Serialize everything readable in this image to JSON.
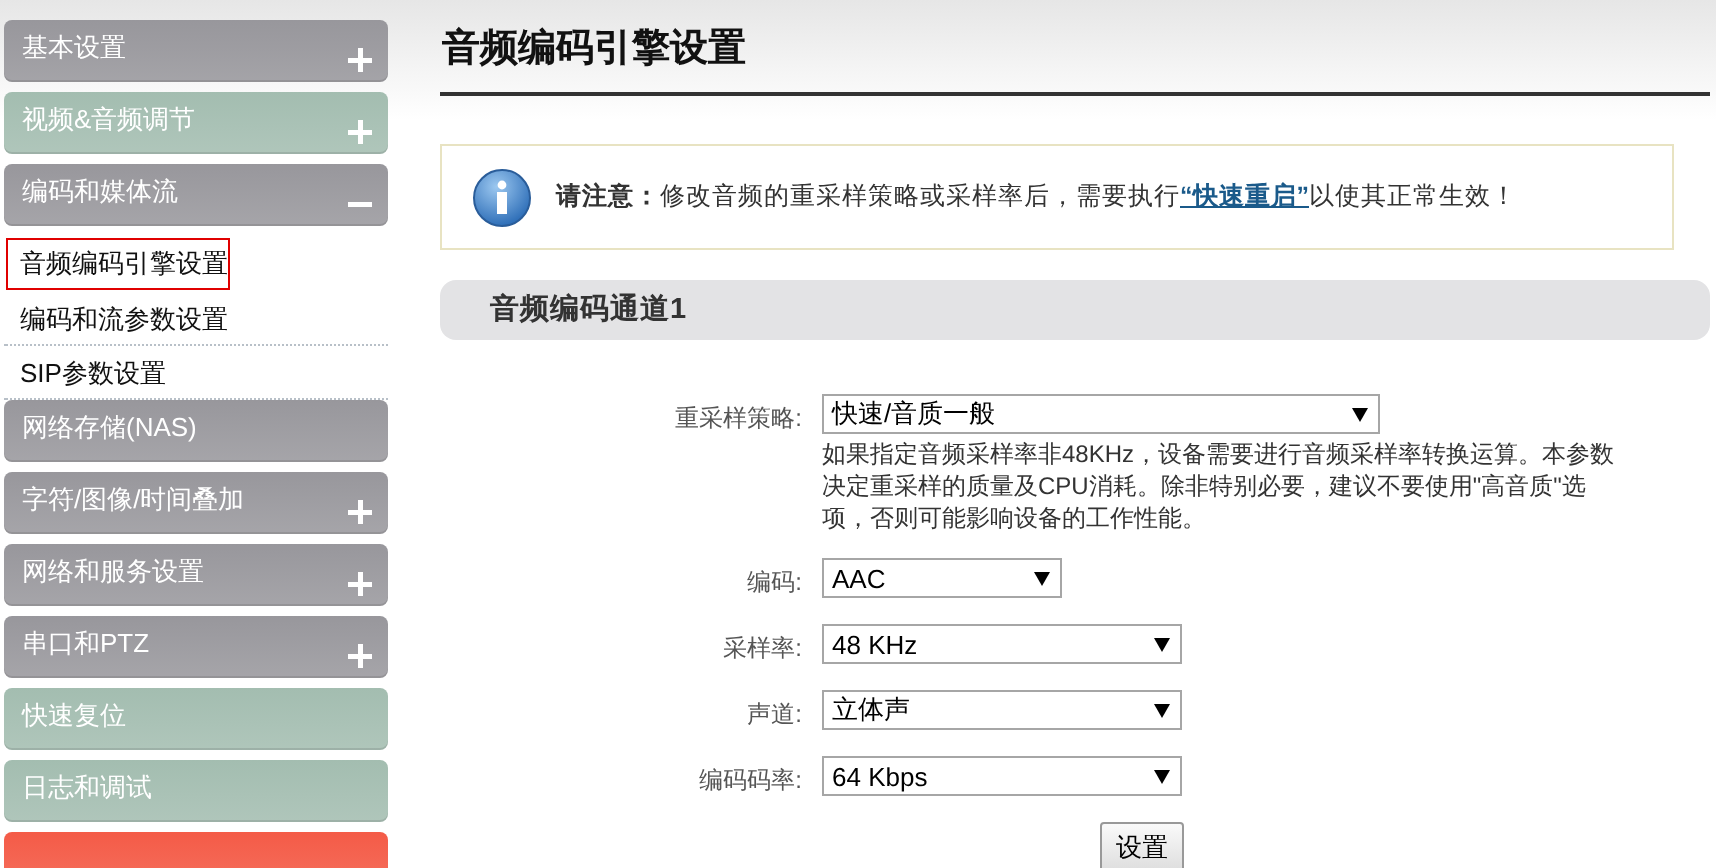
{
  "sidebar": {
    "items": [
      {
        "label": "基本设置",
        "kind": "collapsible",
        "expanded": false,
        "color": "#98979c"
      },
      {
        "label": "视频&音频调节",
        "kind": "collapsible",
        "expanded": false,
        "color": "#a3bdb0"
      },
      {
        "label": "编码和媒体流",
        "kind": "collapsible",
        "expanded": true,
        "color": "#98979c",
        "children": [
          {
            "label": "音频编码引擎设置",
            "selected": true
          },
          {
            "label": "编码和流参数设置",
            "selected": false
          },
          {
            "label": "SIP参数设置",
            "selected": false
          }
        ]
      },
      {
        "label": "网络存储(NAS)",
        "kind": "link",
        "color": "#98979c"
      },
      {
        "label": "字符/图像/时间叠加",
        "kind": "collapsible",
        "expanded": false,
        "color": "#98979c"
      },
      {
        "label": "网络和服务设置",
        "kind": "collapsible",
        "expanded": false,
        "color": "#98979c"
      },
      {
        "label": "串口和PTZ",
        "kind": "collapsible",
        "expanded": false,
        "color": "#98979c"
      },
      {
        "label": "快速复位",
        "kind": "link",
        "color": "#a3bdb0"
      },
      {
        "label": "日志和调试",
        "kind": "link",
        "color": "#a3bdb0"
      },
      {
        "kind": "link",
        "color": "#f45b47"
      }
    ]
  },
  "page": {
    "title": "音频编码引擎设置",
    "notice": {
      "label": "请注意：",
      "text": "修改音频的重采样策略或采样率后，需要执行",
      "link": "“快速重启”",
      "after": "以使其正常生效！"
    },
    "section": {
      "title": "音频编码通道1",
      "fields": [
        {
          "label": "重采样策略:",
          "value": "快速/音质一般",
          "kind": "wide",
          "hint": "如果指定音频采样率非48KHz，设备需要进行音频采样率转换运算。本参数决定重采样的质量及CPU消耗。除非特别必要，建议不要使用\"高音质\"选项，否则可能影响设备的工作性能。"
        },
        {
          "label": "编码:",
          "value": "AAC",
          "kind": "narrow"
        },
        {
          "label": "采样率:",
          "value": "48 KHz",
          "kind": "standard"
        },
        {
          "label": "声道:",
          "value": "立体声",
          "kind": "standard"
        },
        {
          "label": "编码码率:",
          "value": "64 Kbps",
          "kind": "standard"
        }
      ],
      "submit": "设置"
    }
  }
}
